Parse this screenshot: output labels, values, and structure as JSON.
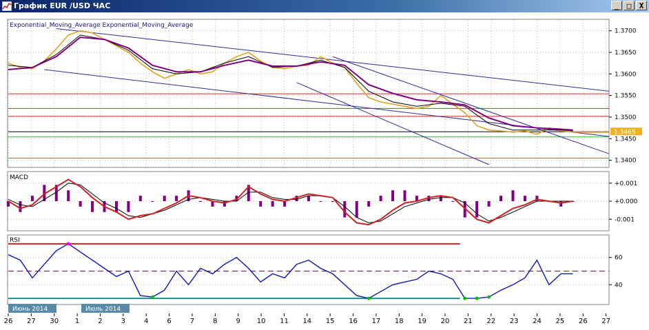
{
  "window": {
    "title": "График EUR /USD  ЧАС",
    "btn_minimize": "_",
    "btn_restore": "□",
    "btn_close": "X"
  },
  "colors": {
    "bg": "#ffffff",
    "frame": "#808080",
    "grid": "#b4b4b4",
    "price": "#e1a21b",
    "ema_fast": "#000000",
    "ema_slow": "#800080",
    "trend": "#2b2b9c",
    "resistance": "#d03030",
    "support": "#30b030",
    "current_line": "#000000",
    "current_tag": "#f0b020",
    "macd_line": "#d02020",
    "macd_signal": "#000000",
    "macd_hist": "#800080",
    "rsi_line": "#0a14b4",
    "rsi_over": "#ff00ff",
    "rsi_under": "#00c000",
    "rsi_upper": "#d02020",
    "rsi_lower": "#2a8a8a",
    "rsi_mid": "#800080",
    "date_tag": "#5a8aaa"
  },
  "chart_data": [
    {
      "type": "line",
      "panel": "price",
      "legend": "Exponential_Moving_Average Exponential_Moving_Average",
      "ylim": [
        1.3385,
        1.3725
      ],
      "yticks": [
        "1.3700",
        "1.3650",
        "1.3600",
        "1.3550",
        "1.3500",
        "1.3450",
        "1.3400"
      ],
      "current_price": "1.3465",
      "price_series": {
        "x": [
          0,
          1,
          2,
          3,
          4,
          5,
          6,
          7,
          8,
          9,
          10,
          11,
          12,
          13,
          14,
          15,
          16,
          17,
          18,
          19,
          20,
          21,
          22,
          23,
          24,
          25,
          26,
          27,
          28,
          29,
          30,
          31,
          32,
          33,
          34,
          35,
          36,
          37,
          38,
          39,
          40,
          41,
          42,
          43,
          44,
          45,
          46,
          47,
          48,
          49,
          50
        ],
        "y": [
          1.3625,
          1.3615,
          1.3612,
          1.363,
          1.3658,
          1.369,
          1.37,
          1.3695,
          1.368,
          1.3665,
          1.365,
          1.3625,
          1.3605,
          1.359,
          1.36,
          1.361,
          1.36,
          1.3605,
          1.3625,
          1.364,
          1.365,
          1.363,
          1.3615,
          1.3612,
          1.3618,
          1.362,
          1.364,
          1.3625,
          1.3615,
          1.3578,
          1.3545,
          1.3535,
          1.353,
          1.3525,
          1.352,
          1.3525,
          1.355,
          1.353,
          1.351,
          1.348,
          1.347,
          1.3468,
          1.3465,
          1.3468,
          1.346,
          1.3475,
          1.3468,
          1.3465,
          1.3465,
          1.3465,
          1.3465
        ]
      },
      "ema_fast": {
        "x": [
          0,
          2,
          4,
          6,
          8,
          10,
          12,
          14,
          16,
          18,
          20,
          22,
          24,
          26,
          28,
          30,
          32,
          34,
          36,
          38,
          40,
          42,
          44,
          46,
          47
        ],
        "y": [
          1.362,
          1.3615,
          1.3645,
          1.369,
          1.368,
          1.3655,
          1.3612,
          1.36,
          1.3605,
          1.3625,
          1.364,
          1.3615,
          1.3618,
          1.3632,
          1.3615,
          1.356,
          1.3535,
          1.3525,
          1.3532,
          1.3525,
          1.3485,
          1.347,
          1.347,
          1.347,
          1.3468
        ]
      },
      "ema_slow": {
        "x": [
          0,
          2,
          4,
          6,
          8,
          10,
          12,
          14,
          16,
          18,
          20,
          22,
          24,
          26,
          28,
          30,
          32,
          34,
          36,
          38,
          40,
          42,
          44,
          46,
          47
        ],
        "y": [
          1.361,
          1.3615,
          1.364,
          1.3685,
          1.368,
          1.366,
          1.362,
          1.3605,
          1.3605,
          1.362,
          1.3632,
          1.3618,
          1.3618,
          1.3628,
          1.362,
          1.3575,
          1.3555,
          1.354,
          1.3535,
          1.3528,
          1.3498,
          1.348,
          1.3475,
          1.3472,
          1.347
        ]
      },
      "horizontal_levels": {
        "resistance": [
          1.3554,
          1.352,
          1.3502
        ],
        "support": [
          1.3454,
          1.3405
        ],
        "current": 1.3466
      },
      "trend_lines": [
        {
          "x": [
            4,
            50
          ],
          "y": [
            1.3705,
            1.356
          ]
        },
        {
          "x": [
            3,
            50
          ],
          "y": [
            1.361,
            1.3455
          ]
        },
        {
          "x": [
            27,
            50
          ],
          "y": [
            1.364,
            1.3415
          ]
        },
        {
          "x": [
            24,
            40
          ],
          "y": [
            1.358,
            1.339
          ]
        }
      ]
    },
    {
      "type": "line",
      "panel": "macd",
      "legend": "MACD",
      "ylim": [
        -0.0016,
        0.0016
      ],
      "yticks": [
        "+0.001",
        "+0.000",
        "-0.001"
      ],
      "macd": {
        "x": [
          0,
          1,
          2,
          3,
          4,
          5,
          6,
          7,
          8,
          9,
          10,
          11,
          12,
          13,
          14,
          15,
          16,
          17,
          18,
          19,
          20,
          21,
          22,
          23,
          24,
          25,
          26,
          27,
          28,
          29,
          30,
          31,
          32,
          33,
          34,
          35,
          36,
          37,
          38,
          39,
          40,
          41,
          42,
          43,
          44,
          45,
          46,
          47
        ],
        "y": [
          0.0,
          -0.0004,
          -0.0002,
          0.0004,
          0.0008,
          0.0012,
          0.0008,
          0.0002,
          -0.0003,
          -0.0006,
          -0.001,
          -0.0008,
          -0.0007,
          -0.0004,
          -0.0001,
          0.0003,
          0.0002,
          0.0,
          -0.0001,
          0.0001,
          0.0008,
          0.0004,
          0.0001,
          0.0,
          0.0002,
          0.0004,
          0.0003,
          0.0002,
          -0.0006,
          -0.0012,
          -0.0013,
          -0.001,
          -0.0005,
          -0.0001,
          0.0,
          0.0002,
          0.0003,
          0.0002,
          -0.0004,
          -0.001,
          -0.0012,
          -0.0008,
          -0.0004,
          -0.0002,
          0.0001,
          0.0,
          -0.0001,
          0.0
        ]
      },
      "signal": {
        "x": [
          0,
          1,
          2,
          3,
          4,
          5,
          6,
          7,
          8,
          9,
          10,
          11,
          12,
          13,
          14,
          15,
          16,
          17,
          18,
          19,
          20,
          21,
          22,
          23,
          24,
          25,
          26,
          27,
          28,
          29,
          30,
          31,
          32,
          33,
          34,
          35,
          36,
          37,
          38,
          39,
          40,
          41,
          42,
          43,
          44,
          45,
          46,
          47
        ],
        "y": [
          0.0001,
          -0.0002,
          -0.0003,
          0.0001,
          0.0005,
          0.001,
          0.0009,
          0.0004,
          -0.0001,
          -0.0004,
          -0.0008,
          -0.0009,
          -0.0007,
          -0.0005,
          -0.0002,
          0.0001,
          0.0002,
          0.0001,
          0.0,
          0.0,
          0.0005,
          0.0005,
          0.0002,
          0.0001,
          0.0001,
          0.0003,
          0.0003,
          0.0002,
          -0.0003,
          -0.0009,
          -0.0012,
          -0.0011,
          -0.0007,
          -0.0003,
          -0.0001,
          0.0001,
          0.0002,
          0.0002,
          -0.0001,
          -0.0007,
          -0.0011,
          -0.0009,
          -0.0006,
          -0.0003,
          0.0,
          0.0,
          0.0,
          0.0
        ]
      }
    },
    {
      "type": "line",
      "panel": "rsi",
      "legend": "RSI",
      "ylim": [
        26,
        76
      ],
      "yticks": [
        "60",
        "40"
      ],
      "levels": {
        "upper": 70,
        "middle": 50,
        "lower": 30
      },
      "rsi": {
        "x": [
          0,
          1,
          2,
          3,
          4,
          5,
          6,
          7,
          8,
          9,
          10,
          11,
          12,
          13,
          14,
          15,
          16,
          17,
          18,
          19,
          20,
          21,
          22,
          23,
          24,
          25,
          26,
          27,
          28,
          29,
          30,
          31,
          32,
          33,
          34,
          35,
          36,
          37,
          38,
          39,
          40,
          41,
          42,
          43,
          44,
          45,
          46,
          47
        ],
        "y": [
          62,
          58,
          45,
          55,
          65,
          70,
          64,
          58,
          52,
          46,
          50,
          32,
          31,
          36,
          50,
          40,
          52,
          48,
          55,
          60,
          52,
          42,
          48,
          45,
          55,
          58,
          52,
          48,
          40,
          32,
          30,
          35,
          40,
          42,
          44,
          50,
          48,
          44,
          30,
          30,
          31,
          36,
          40,
          45,
          58,
          40,
          48,
          48
        ]
      }
    }
  ],
  "x_axis": {
    "labels": [
      "26",
      "27",
      "30",
      "1",
      "2",
      "3",
      "4",
      "6",
      "7",
      "8",
      "9",
      "10",
      "11",
      "14",
      "15",
      "16",
      "17",
      "18",
      "19",
      "20",
      "21",
      "22",
      "23",
      "24",
      "25",
      "26",
      "27"
    ],
    "month_tags": [
      "Июнь 2014",
      "Июль 2014"
    ]
  }
}
